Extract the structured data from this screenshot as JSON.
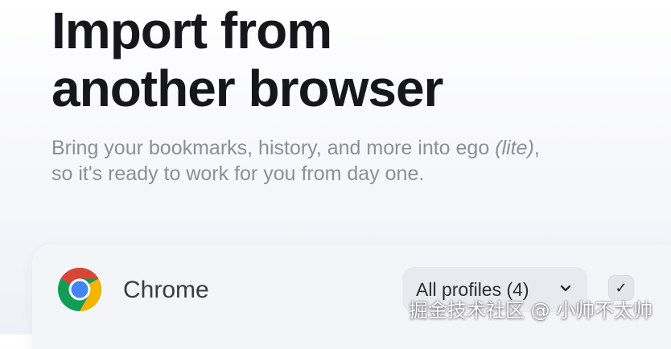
{
  "header": {
    "title_line1": "Import from",
    "title_line2": "another browser"
  },
  "subtitle": {
    "line1_prefix": "Bring your bookmarks, history, and more into ego ",
    "line1_emphasis": "(lite)",
    "line1_suffix": ",",
    "line2": "so it's ready to work for you from day one."
  },
  "browsers": [
    {
      "name": "Chrome",
      "icon": "chrome-icon",
      "profile_select": "All profiles (4)",
      "checked": true,
      "check_glyph": "✓"
    }
  ],
  "watermark": "掘金技术社区 @ 小帅不太帅",
  "colors": {
    "title": "#16171a",
    "subtitle": "#8b8f97",
    "card": "#f4f5f8",
    "select_bg": "#e8eaef",
    "chrome_red": "#db4437",
    "chrome_green": "#0f9d58",
    "chrome_yellow": "#f4b400",
    "chrome_blue": "#4285f4"
  }
}
